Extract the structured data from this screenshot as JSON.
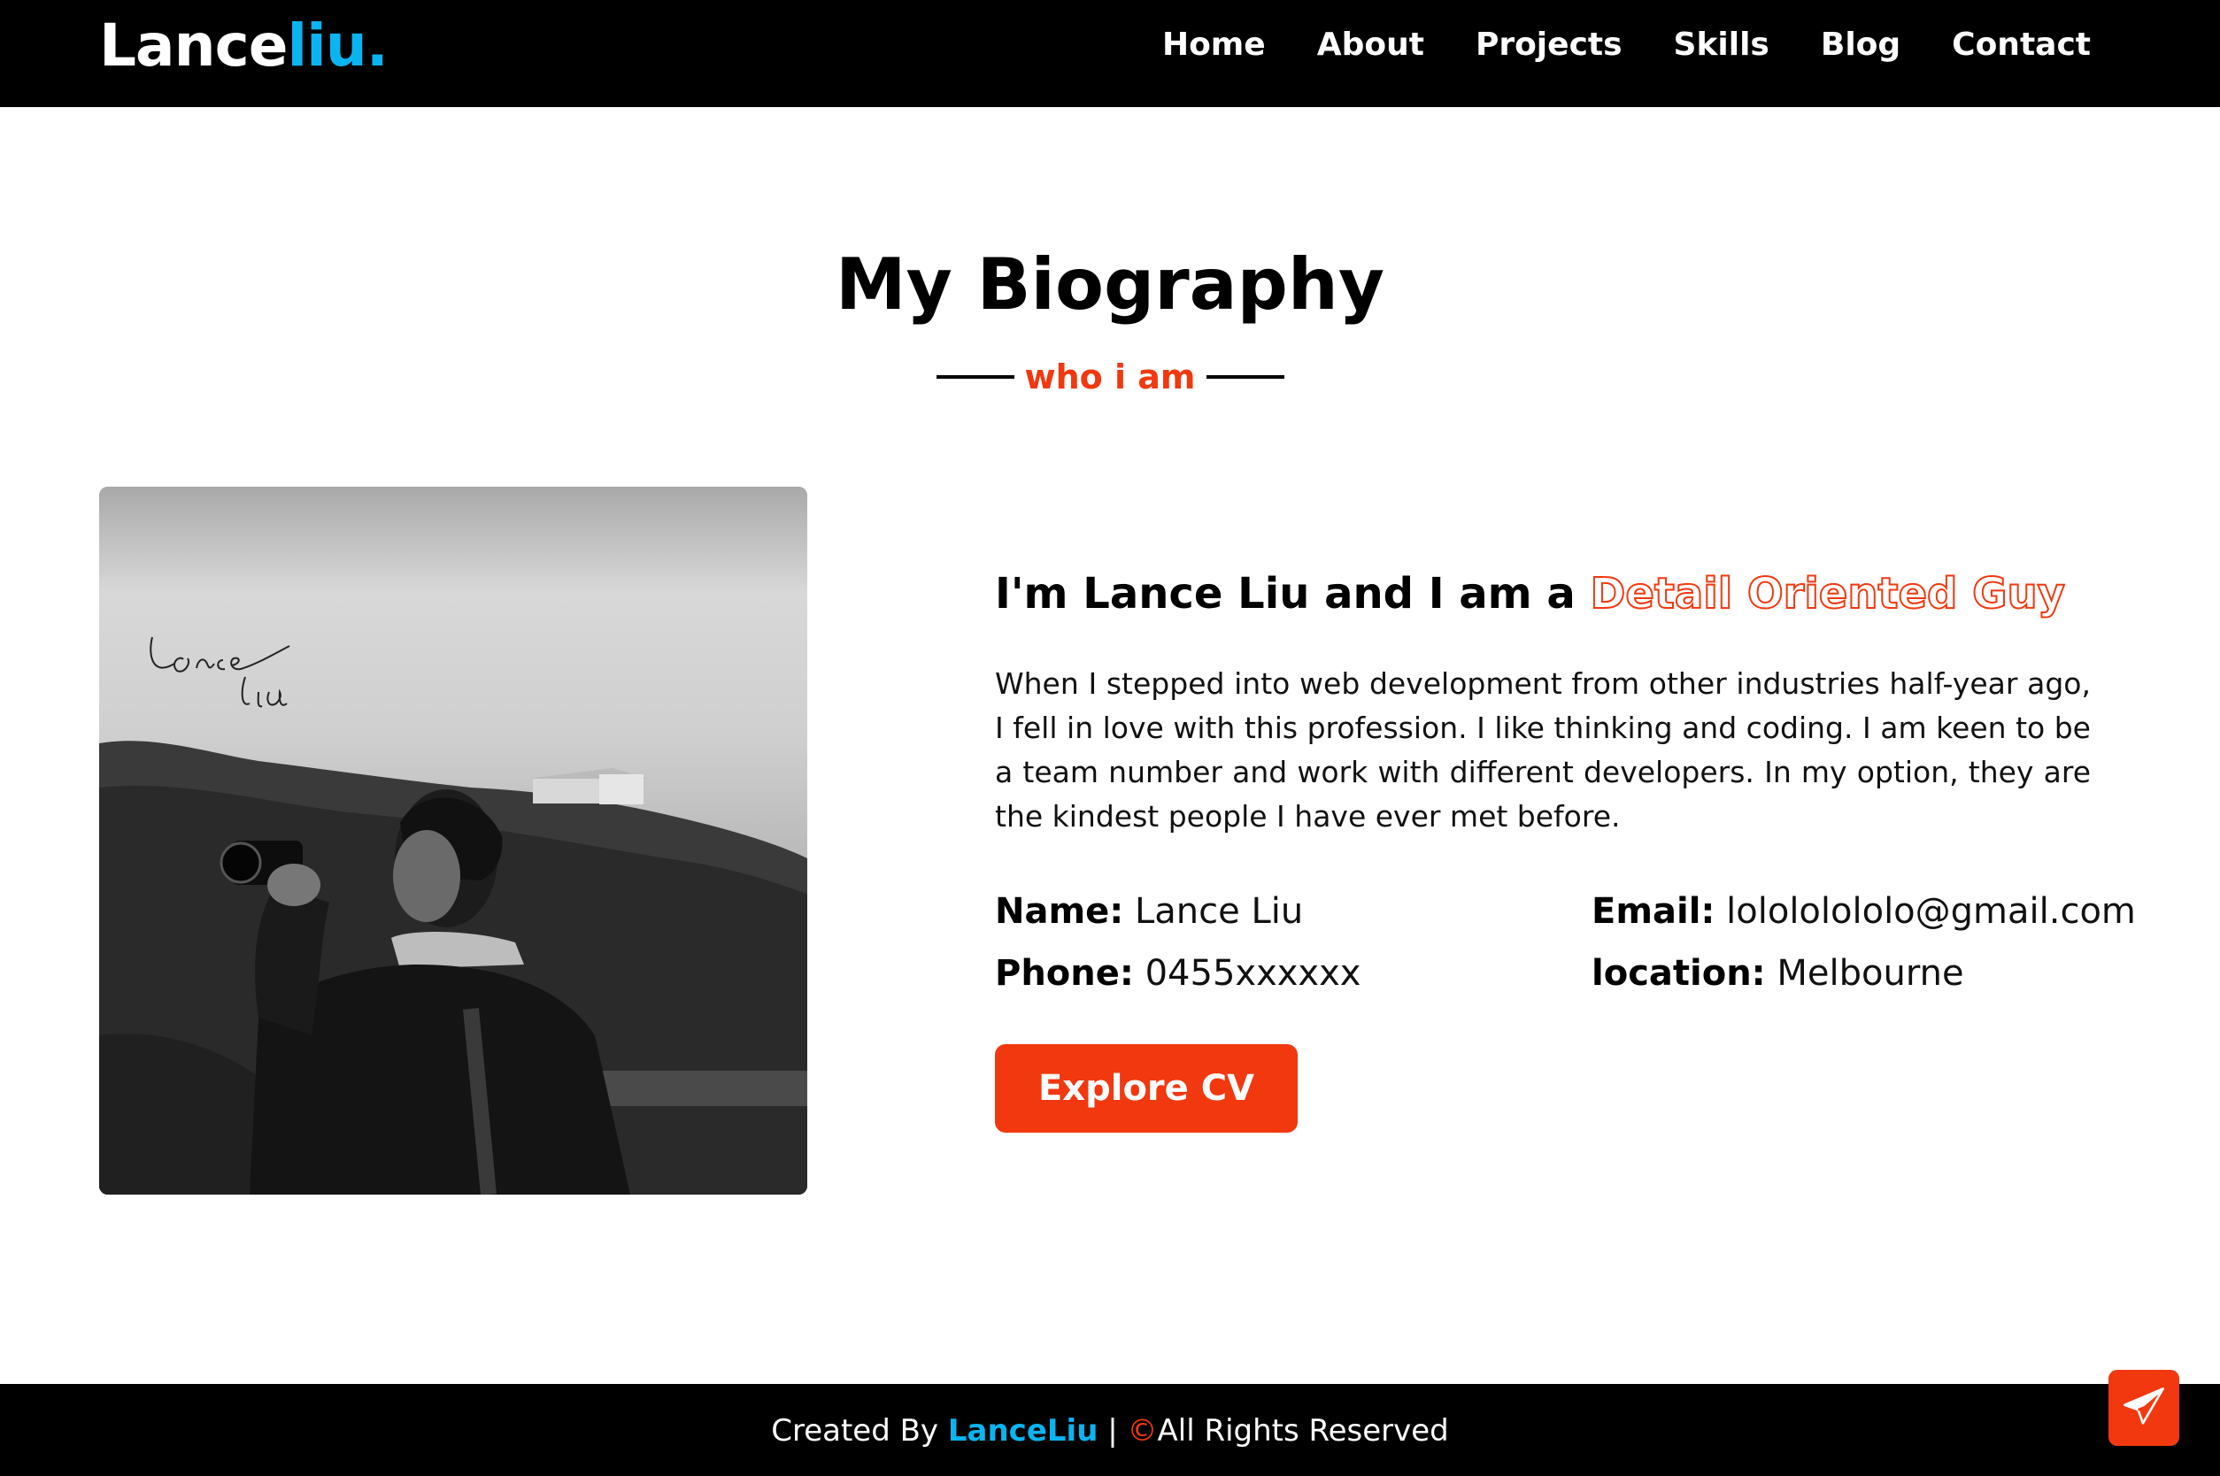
{
  "nav": {
    "logo_main": "Lance",
    "logo_accent": "liu.",
    "links": [
      "Home",
      "About",
      "Projects",
      "Skills",
      "Blog",
      "Contact"
    ]
  },
  "section": {
    "title": "My Biography",
    "subtitle": "who i am"
  },
  "photo": {
    "signature_text": "Lance Liu"
  },
  "about": {
    "heading_prefix": "I'm Lance Liu and I am a ",
    "heading_highlight": "Detail Oriented Guy",
    "paragraph": "When I stepped into web development from other industries half-year ago, I fell in love with this profession. I like thinking and coding. I am keen to be a team number and work with different developers. In my option, they are the kindest people I have ever met before.",
    "info": {
      "name_label": "Name:",
      "name_value": "Lance Liu",
      "email_label": "Email:",
      "email_value": "lolololololo@gmail.com",
      "phone_label": "Phone:",
      "phone_value": "0455xxxxxx",
      "location_label": "location:",
      "location_value": "Melbourne"
    },
    "cta_label": "Explore CV"
  },
  "footer": {
    "prefix": "Created By ",
    "brand": "LanceLiu",
    "separator": " | ",
    "copyright_symbol": "©",
    "suffix": "All Rights Reserved"
  },
  "icons": {
    "scroll_top": "paper-plane-icon"
  },
  "colors": {
    "accent": "#f2380f",
    "brand_blue": "#0ab4f0",
    "nav_bg": "#000000"
  }
}
